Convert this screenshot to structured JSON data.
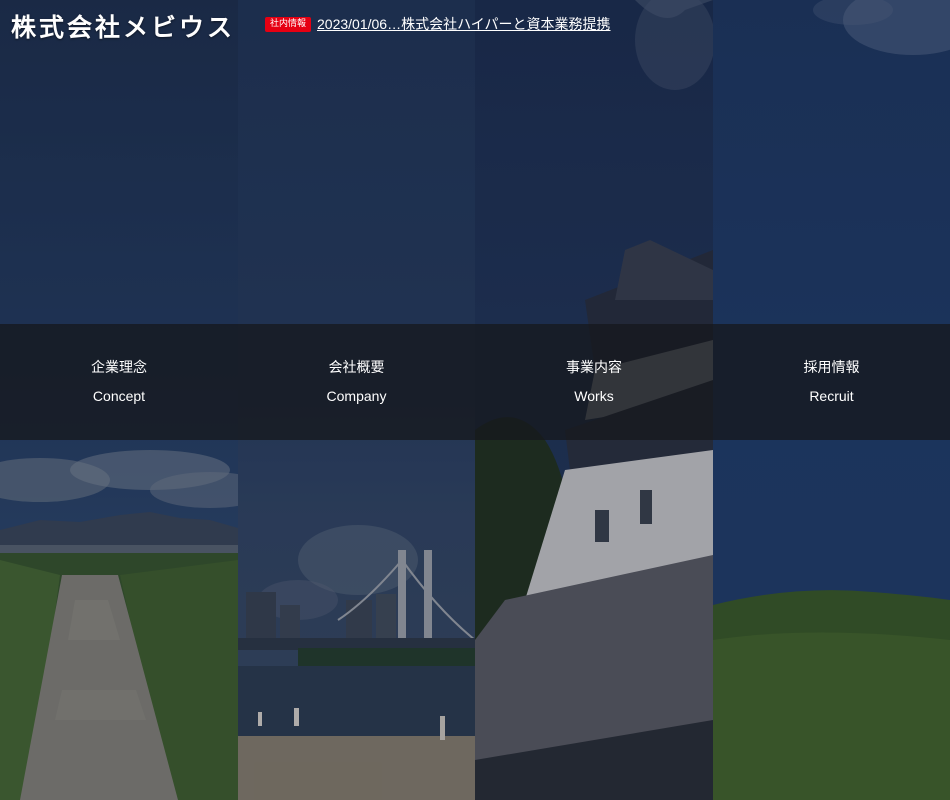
{
  "header": {
    "logo": "株式会社メビウス",
    "news": {
      "badge": "社内情報",
      "link": "2023/01/06…株式会社ハイパーと資本業務提携"
    }
  },
  "nav": {
    "items": [
      {
        "ja": "企業理念",
        "en": "Concept"
      },
      {
        "ja": "会社概要",
        "en": "Company"
      },
      {
        "ja": "事業内容",
        "en": "Works"
      },
      {
        "ja": "採用情報",
        "en": "Recruit"
      }
    ]
  },
  "colors": {
    "news_badge": "#e60012",
    "nav_overlay": "#16181e",
    "sky": "#1f3252"
  }
}
